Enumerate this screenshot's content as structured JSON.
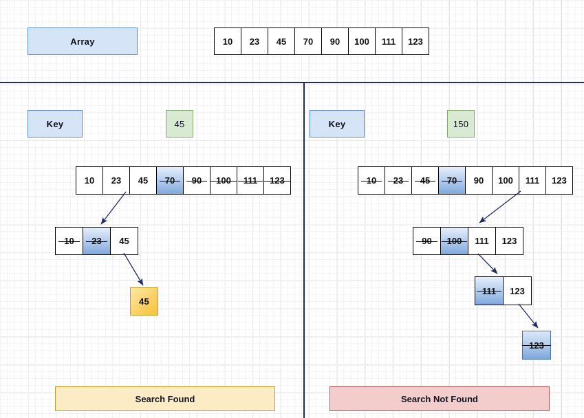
{
  "diagram": {
    "title_label": "Array",
    "key_label": "Key"
  },
  "colors": {
    "label_blue_fill": "#d6e4f7",
    "label_blue_border": "#5b87c4",
    "key_green_fill": "#d9ead3",
    "key_green_border": "#82a96a",
    "highlight_blue": "#7fa9dd",
    "result_yellow": "#fbd167",
    "banner_found_fill": "#fbecc5",
    "banner_notfound_fill": "#f3cccc",
    "divider": "#1f2a5e",
    "arrow": "#1f2a5e"
  },
  "header": {
    "array_label": "Array",
    "array_values": [
      "10",
      "23",
      "45",
      "70",
      "90",
      "100",
      "111",
      "123"
    ]
  },
  "left_panel": {
    "key_label": "Key",
    "key_value": "45",
    "rows": [
      {
        "cells": [
          {
            "value": "10",
            "highlighted": false,
            "struck": false
          },
          {
            "value": "23",
            "highlighted": false,
            "struck": false
          },
          {
            "value": "45",
            "highlighted": false,
            "struck": false
          },
          {
            "value": "70",
            "highlighted": true,
            "struck": true
          },
          {
            "value": "90",
            "highlighted": false,
            "struck": true
          },
          {
            "value": "100",
            "highlighted": false,
            "struck": true
          },
          {
            "value": "111",
            "highlighted": false,
            "struck": true
          },
          {
            "value": "123",
            "highlighted": false,
            "struck": true
          }
        ]
      },
      {
        "cells": [
          {
            "value": "10",
            "highlighted": false,
            "struck": true
          },
          {
            "value": "23",
            "highlighted": true,
            "struck": true
          },
          {
            "value": "45",
            "highlighted": false,
            "struck": false
          }
        ]
      }
    ],
    "result_value": "45",
    "banner_label": "Search Found"
  },
  "right_panel": {
    "key_label": "Key",
    "key_value": "150",
    "rows": [
      {
        "cells": [
          {
            "value": "10",
            "highlighted": false,
            "struck": true
          },
          {
            "value": "23",
            "highlighted": false,
            "struck": true
          },
          {
            "value": "45",
            "highlighted": false,
            "struck": true
          },
          {
            "value": "70",
            "highlighted": true,
            "struck": true
          },
          {
            "value": "90",
            "highlighted": false,
            "struck": false
          },
          {
            "value": "100",
            "highlighted": false,
            "struck": false
          },
          {
            "value": "111",
            "highlighted": false,
            "struck": false
          },
          {
            "value": "123",
            "highlighted": false,
            "struck": false
          }
        ]
      },
      {
        "cells": [
          {
            "value": "90",
            "highlighted": false,
            "struck": true
          },
          {
            "value": "100",
            "highlighted": true,
            "struck": true
          },
          {
            "value": "111",
            "highlighted": false,
            "struck": false
          },
          {
            "value": "123",
            "highlighted": false,
            "struck": false
          }
        ]
      },
      {
        "cells": [
          {
            "value": "111",
            "highlighted": true,
            "struck": true
          },
          {
            "value": "123",
            "highlighted": false,
            "struck": false
          }
        ]
      }
    ],
    "result_value": "123",
    "banner_label": "Search Not  Found"
  }
}
